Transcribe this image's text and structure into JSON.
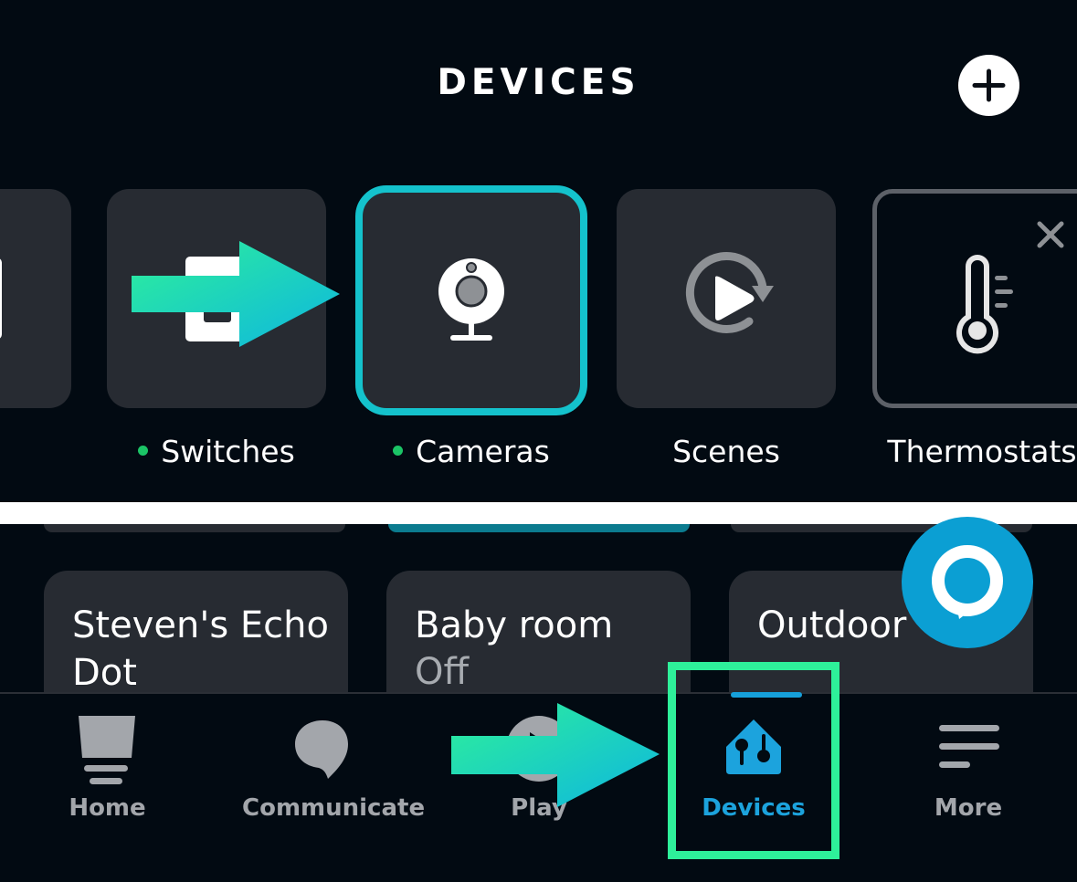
{
  "header": {
    "title": "DEVICES",
    "add_button_icon": "plus-circle-icon"
  },
  "categories": [
    {
      "label": "",
      "icon": "partial-tile-icon",
      "status_dot": false,
      "partial": true
    },
    {
      "label": "Switches",
      "icon": "light-switch-icon",
      "status_dot": true
    },
    {
      "label": "Cameras",
      "icon": "webcam-icon",
      "status_dot": true,
      "selected": true
    },
    {
      "label": "Scenes",
      "icon": "scene-play-refresh-icon",
      "status_dot": false
    },
    {
      "label": "Thermostats",
      "icon": "thermometer-icon",
      "status_dot": false,
      "dismissible": true
    }
  ],
  "devices": [
    {
      "name": "Steven's Echo Dot",
      "state": ""
    },
    {
      "name": "Baby room",
      "state": "Off"
    },
    {
      "name": "Outdoor",
      "state": ""
    }
  ],
  "alexa_button": {
    "icon": "alexa-icon"
  },
  "nav": {
    "items": [
      {
        "label": "Home",
        "icon": "home-echo-icon"
      },
      {
        "label": "Communicate",
        "icon": "speech-bubble-icon"
      },
      {
        "label": "Play",
        "icon": "play-icon"
      },
      {
        "label": "Devices",
        "icon": "devices-house-icon",
        "active": true
      },
      {
        "label": "More",
        "icon": "menu-lines-icon"
      }
    ]
  },
  "colors": {
    "background": "#020a12",
    "tile": "#272b32",
    "selected_border": "#14c2cc",
    "status_green": "#1bc466",
    "accent_blue": "#1ca3dd",
    "highlight_green": "#2ef09a"
  }
}
